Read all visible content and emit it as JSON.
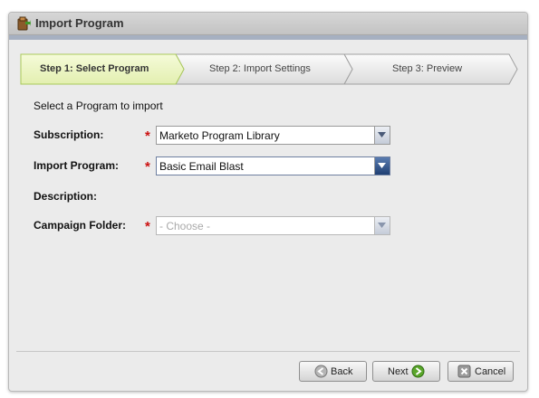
{
  "window": {
    "title": "Import Program",
    "title_icon": "import-box-icon"
  },
  "wizard": {
    "steps": [
      {
        "label": "Step 1: Select Program",
        "active": true
      },
      {
        "label": "Step 2: Import Settings",
        "active": false
      },
      {
        "label": "Step 3: Preview",
        "active": false
      }
    ]
  },
  "form": {
    "intro": "Select a Program to import",
    "subscription": {
      "label": "Subscription:",
      "required": true,
      "value": "Marketo Program Library"
    },
    "import_program": {
      "label": "Import Program:",
      "required": true,
      "value": "Basic Email Blast"
    },
    "description": {
      "label": "Description:"
    },
    "campaign_folder": {
      "label": "Campaign Folder:",
      "required": true,
      "placeholder": "- Choose -"
    },
    "required_marker": "*"
  },
  "buttons": {
    "back": {
      "label": "Back",
      "icon": "arrow-left-circle-icon"
    },
    "next": {
      "label": "Next",
      "icon": "arrow-right-circle-icon"
    },
    "cancel": {
      "label": "Cancel",
      "icon": "close-square-icon"
    }
  },
  "colors": {
    "active_step": "#eef6c8",
    "active_step_border": "#a9c95a",
    "required": "#cc1111",
    "next_icon": "#5aa62a"
  }
}
